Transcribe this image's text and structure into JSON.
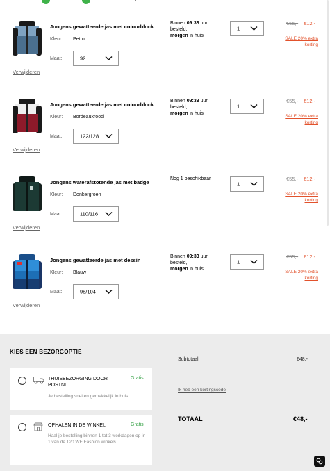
{
  "cart": {
    "items": [
      {
        "title": "Jongens gewatteerde jas met colourblock",
        "color_label": "Kleur:",
        "color_value": "Petrol",
        "size_label": "Maat:",
        "size_value": "92",
        "delivery_prefix": "Binnen ",
        "delivery_time": "09:33",
        "delivery_mid": " uur besteld,",
        "delivery_day": "morgen",
        "delivery_suffix": " in huis",
        "quantity": "1",
        "price_old": "€55,-",
        "price_new": "€12,-",
        "sale_label": "SALE 20% extra korting",
        "remove_label": "Verwijderen"
      },
      {
        "title": "Jongens gewatteerde jas met colourblock",
        "color_label": "Kleur:",
        "color_value": "Bordeauxrood",
        "size_label": "Maat:",
        "size_value": "122/128",
        "delivery_prefix": "Binnen ",
        "delivery_time": "09:33",
        "delivery_mid": " uur besteld,",
        "delivery_day": "morgen",
        "delivery_suffix": " in huis",
        "quantity": "1",
        "price_old": "€55,-",
        "price_new": "€12,-",
        "sale_label": "SALE 20% extra korting",
        "remove_label": "Verwijderen"
      },
      {
        "title": "Jongens waterafstotende jas met badge",
        "color_label": "Kleur:",
        "color_value": "Donkergroen",
        "size_label": "Maat:",
        "size_value": "110/116",
        "stock_note": "Nog 1 beschikbaar",
        "quantity": "1",
        "price_old": "€55,-",
        "price_new": "€12,-",
        "sale_label": "SALE 20% extra korting",
        "remove_label": "Verwijderen"
      },
      {
        "title": "Jongens gewatteerde jas met dessin",
        "color_label": "Kleur:",
        "color_value": "Blauw",
        "size_label": "Maat:",
        "size_value": "98/104",
        "delivery_prefix": "Binnen ",
        "delivery_time": "09:33",
        "delivery_mid": " uur besteld,",
        "delivery_day": "morgen",
        "delivery_suffix": " in huis",
        "quantity": "1",
        "price_old": "€55,-",
        "price_new": "€12,-",
        "sale_label": "SALE 20% extra korting",
        "remove_label": "Verwijderen"
      }
    ]
  },
  "delivery": {
    "title": "KIES EEN BEZORGOPTIE",
    "options": [
      {
        "title": "THUISBEZORGING DOOR POSTNL",
        "price": "Gratis",
        "description": "Je bestelling snel en gemakkelijk in huis",
        "icon": "truck-icon"
      },
      {
        "title": "OPHALEN IN DE WINKEL",
        "price": "Gratis",
        "description": "Haal je bestelling binnen 1 tot 3 werkdagen op in 1 van de 120 WE Fashion winkels",
        "icon": "store-icon"
      }
    ]
  },
  "summary": {
    "subtotal_label": "Subtotaal",
    "subtotal_value": "€48,-",
    "coupon_link": "Ik heb een kortingscode",
    "total_label": "TOTAAL",
    "total_value": "€48,-"
  },
  "colors": {
    "accent_sale": "#e2522c",
    "free_green": "#3aa34a",
    "jacket_1": "#5a86a8",
    "jacket_2": "#8e1a2a",
    "jacket_3": "#1c3a34",
    "jacket_4": "#1d6fb6"
  }
}
